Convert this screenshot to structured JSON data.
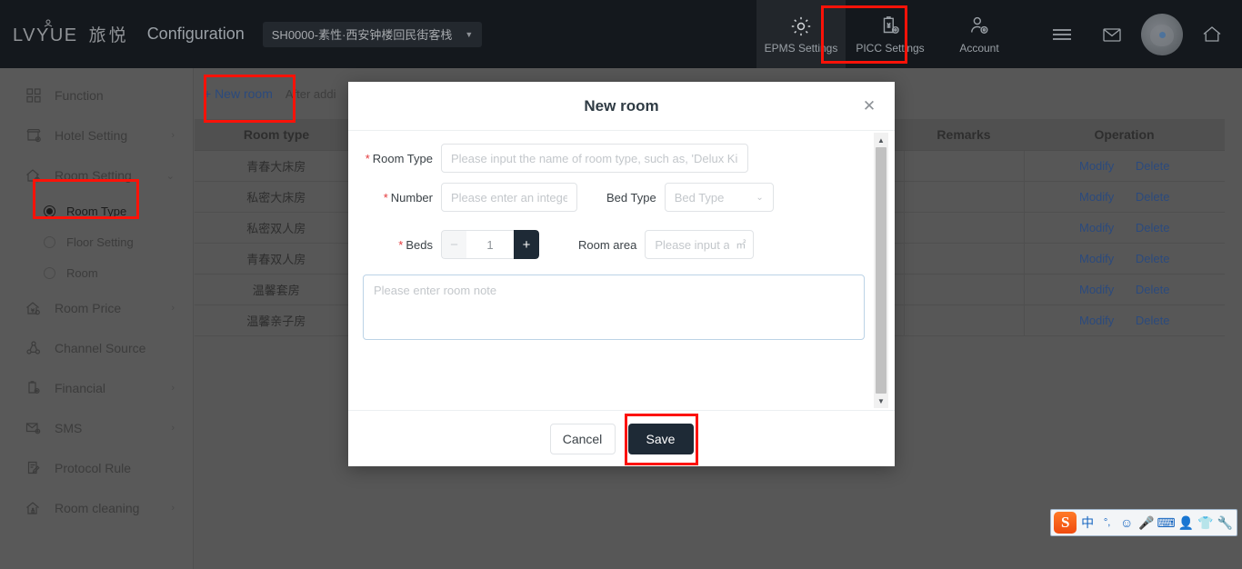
{
  "topbar": {
    "logo_latin": "LVYUE",
    "logo_cn": "旅悦",
    "app_title": "Configuration",
    "hotel_selector": {
      "value": "SH0000-素性·西安钟楼回民街客栈",
      "caret": "▼"
    },
    "actions": [
      {
        "label": "EPMS Settings",
        "icon": "gear-icon",
        "active": true
      },
      {
        "label": "PICC Settings",
        "icon": "clipboard-yen-icon",
        "active": false
      },
      {
        "label": "Account",
        "icon": "user-gear-icon",
        "active": false
      }
    ],
    "icons": [
      {
        "name": "menu-icon"
      },
      {
        "name": "mail-icon"
      },
      {
        "name": "avatar"
      },
      {
        "name": "home-icon"
      }
    ]
  },
  "sidebar": {
    "items": [
      {
        "label": "Function",
        "icon": "grid-icon",
        "arrow": "",
        "expandable": false
      },
      {
        "label": "Hotel Setting",
        "icon": "shop-gear-icon",
        "arrow": "›",
        "expandable": true
      },
      {
        "label": "Room Setting",
        "icon": "house-gear-icon",
        "arrow": "⌄",
        "expandable": true,
        "expanded": true
      },
      {
        "label": "Room Price",
        "icon": "house-price-icon",
        "arrow": "›",
        "expandable": true
      },
      {
        "label": "Channel Source",
        "icon": "share-icon",
        "arrow": "",
        "expandable": false
      },
      {
        "label": "Financial",
        "icon": "clipboard-gear-icon",
        "arrow": "›",
        "expandable": true
      },
      {
        "label": "SMS",
        "icon": "sms-icon",
        "arrow": "›",
        "expandable": true
      },
      {
        "label": "Protocol Rule",
        "icon": "document-edit-icon",
        "arrow": "",
        "expandable": false
      },
      {
        "label": "Room cleaning",
        "icon": "house-clean-icon",
        "arrow": "›",
        "expandable": true
      }
    ],
    "room_setting_children": [
      {
        "label": "Room Type",
        "selected": true
      },
      {
        "label": "Floor Setting",
        "selected": false
      },
      {
        "label": "Room",
        "selected": false
      }
    ]
  },
  "content": {
    "toolbar": {
      "new_room_label": "+ New room",
      "note": "After addi"
    },
    "table": {
      "columns": [
        "Room type",
        "",
        "",
        "Remarks",
        "Operation"
      ],
      "rows": [
        {
          "room_type": "青春大床房",
          "remarks": "",
          "modify": "Modify",
          "delete": "Delete"
        },
        {
          "room_type": "私密大床房",
          "remarks": "",
          "modify": "Modify",
          "delete": "Delete"
        },
        {
          "room_type": "私密双人房",
          "remarks": "",
          "modify": "Modify",
          "delete": "Delete"
        },
        {
          "room_type": "青春双人房",
          "remarks": "",
          "modify": "Modify",
          "delete": "Delete"
        },
        {
          "room_type": "温馨套房",
          "remarks": "",
          "modify": "Modify",
          "delete": "Delete"
        },
        {
          "room_type": "温馨亲子房",
          "remarks": "",
          "modify": "Modify",
          "delete": "Delete"
        }
      ]
    }
  },
  "modal": {
    "title": "New room",
    "close": "✕",
    "fields": {
      "room_type": {
        "label": "Room Type",
        "required": true,
        "value": "",
        "placeholder": "Please input the name of room type, such as, 'Delux King Size"
      },
      "number": {
        "label": "Number",
        "required": true,
        "value": "",
        "placeholder": "Please enter an integer"
      },
      "bed_type": {
        "label": "Bed Type",
        "required": false,
        "value": "",
        "placeholder": "Bed Type",
        "chevron": "⌄"
      },
      "beds": {
        "label": "Beds",
        "required": true,
        "value": "1",
        "minus": "−",
        "plus": "+"
      },
      "room_area": {
        "label": "Room area",
        "required": false,
        "value": "",
        "placeholder": "Please input ar",
        "unit": "㎡"
      },
      "note": {
        "value": "",
        "placeholder": "Please enter room note"
      }
    },
    "scrollbar": {
      "up": "▲",
      "down": "▼"
    },
    "buttons": {
      "cancel": "Cancel",
      "save": "Save"
    }
  },
  "ime": {
    "logo": "S",
    "items": [
      "中",
      "°,",
      "☺",
      "🎤",
      "⌨",
      "👤",
      "👕",
      "🔧"
    ]
  },
  "colors": {
    "topbar_bg": "#14181d",
    "sidebar_bg": "#595959",
    "content_bg": "#575757",
    "accent_link": "#2b4a7d",
    "primary_button": "#1e2a36",
    "required_star": "#e4393c",
    "annotation_red": "#fc1208"
  }
}
